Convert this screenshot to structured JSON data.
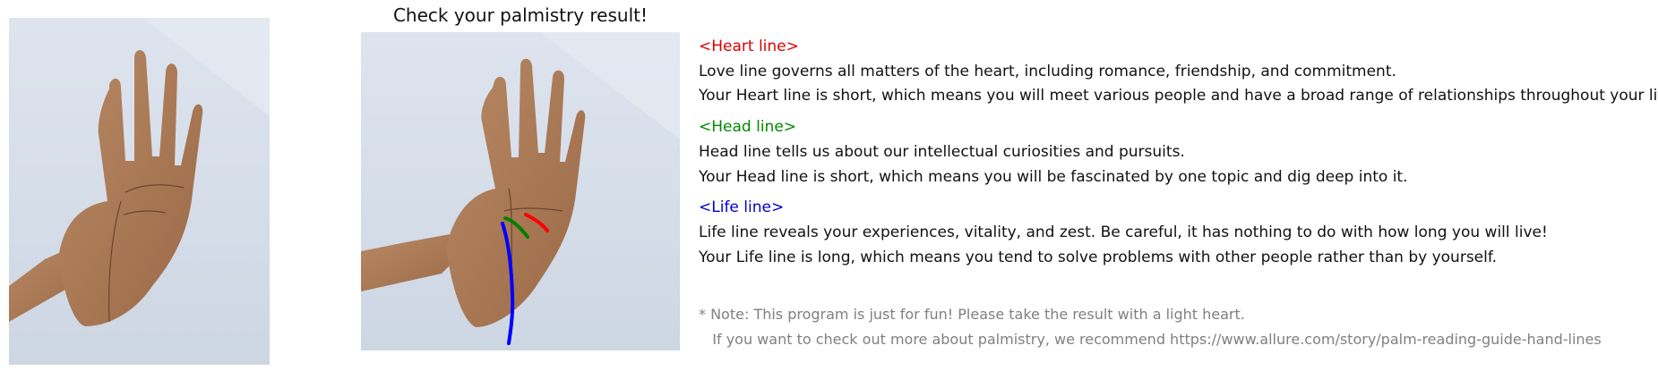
{
  "header": {
    "title": "Check your palmistry result!"
  },
  "images": {
    "left": {
      "name": "original-palm-photo"
    },
    "right": {
      "name": "annotated-palm-photo"
    }
  },
  "line_colors": {
    "heart": "#ff0000",
    "head": "#008000",
    "life": "#0000ff"
  },
  "result": {
    "heart": {
      "heading": "<Heart line>",
      "desc": "Love line governs all matters of the heart, including romance, friendship, and commitment.",
      "verdict": "Your Heart line is short, which means you will meet various people and have a broad range of relationships throughout your life."
    },
    "head": {
      "heading": "<Head line>",
      "desc": "Head line tells us about our intellectual curiosities and pursuits.",
      "verdict": "Your Head line is short, which means you will be fascinated by one topic and dig deep into it."
    },
    "life": {
      "heading": "<Life line>",
      "desc": "Life line reveals your experiences, vitality, and zest. Be careful, it has nothing to do with how long you will live!",
      "verdict": "Your Life line is long, which means you tend to solve problems with other people rather than by yourself."
    }
  },
  "note": {
    "line1": "* Note: This program is just for fun! Please take the result with a light heart.",
    "line2": "   If you want to check out more about palmistry, we recommend https://www.allure.com/story/palm-reading-guide-hand-lines"
  }
}
